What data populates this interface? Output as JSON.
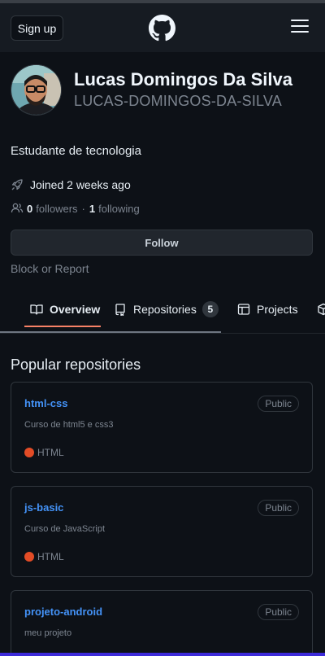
{
  "header": {
    "signup_label": "Sign up",
    "logo_icon": "github-mark-icon",
    "menu_icon": "hamburger-menu-icon"
  },
  "profile": {
    "name": "Lucas Domingos Da Silva",
    "username": "LUCAS-DOMINGOS-DA-SILVA",
    "bio": "Estudante de tecnologia",
    "joined": "Joined 2 weeks ago",
    "followers_count": "0",
    "followers_label": "followers",
    "separator": "·",
    "following_count": "1",
    "following_label": "following",
    "follow_label": "Follow",
    "block_label": "Block or Report"
  },
  "tabs": [
    {
      "label": "Overview",
      "icon": "book-icon",
      "active": true
    },
    {
      "label": "Repositories",
      "icon": "repo-icon",
      "count": "5"
    },
    {
      "label": "Projects",
      "icon": "table-icon"
    },
    {
      "label": "",
      "icon": "package-icon"
    }
  ],
  "popular": {
    "title": "Popular repositories",
    "repos": [
      {
        "name": "html-css",
        "visibility": "Public",
        "description": "Curso de html5 e css3",
        "language": "HTML",
        "language_color": "#e34c26"
      },
      {
        "name": "js-basic",
        "visibility": "Public",
        "description": "Curso de JavaScript",
        "language": "HTML",
        "language_color": "#e34c26"
      },
      {
        "name": "projeto-android",
        "visibility": "Public",
        "description": "meu projeto",
        "language": "",
        "language_color": ""
      }
    ]
  },
  "colors": {
    "background": "#0d1117",
    "header": "#161b22",
    "link": "#4493f8",
    "tab_underline": "#f78166",
    "html_language": "#e34c26"
  }
}
